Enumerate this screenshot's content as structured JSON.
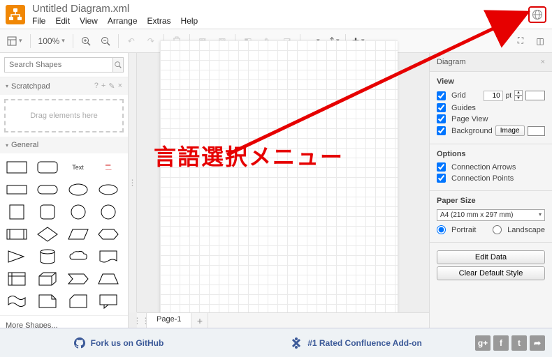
{
  "title": "Untitled Diagram.xml",
  "menu": [
    "File",
    "Edit",
    "View",
    "Arrange",
    "Extras",
    "Help"
  ],
  "zoom": "100%",
  "search": {
    "placeholder": "Search Shapes"
  },
  "scratchpad": {
    "label": "Scratchpad",
    "hint": "Drag elements here"
  },
  "sections": {
    "general": "General"
  },
  "moreShapes": "More Shapes...",
  "tabs": {
    "page1": "Page-1"
  },
  "rightPanel": {
    "title": "Diagram",
    "view": {
      "heading": "View",
      "grid": "Grid",
      "gridSize": "10",
      "gridUnit": "pt",
      "guides": "Guides",
      "pageView": "Page View",
      "background": "Background",
      "imageBtn": "Image"
    },
    "options": {
      "heading": "Options",
      "connArrows": "Connection Arrows",
      "connPoints": "Connection Points"
    },
    "paper": {
      "heading": "Paper Size",
      "size": "A4 (210 mm x 297 mm)",
      "portrait": "Portrait",
      "landscape": "Landscape"
    },
    "editData": "Edit Data",
    "clearStyle": "Clear Default Style"
  },
  "footer": {
    "github": "Fork us on GitHub",
    "confluence": "#1 Rated Confluence Add-on"
  },
  "annotation": "言語選択メニュー",
  "shapeText": "Text"
}
